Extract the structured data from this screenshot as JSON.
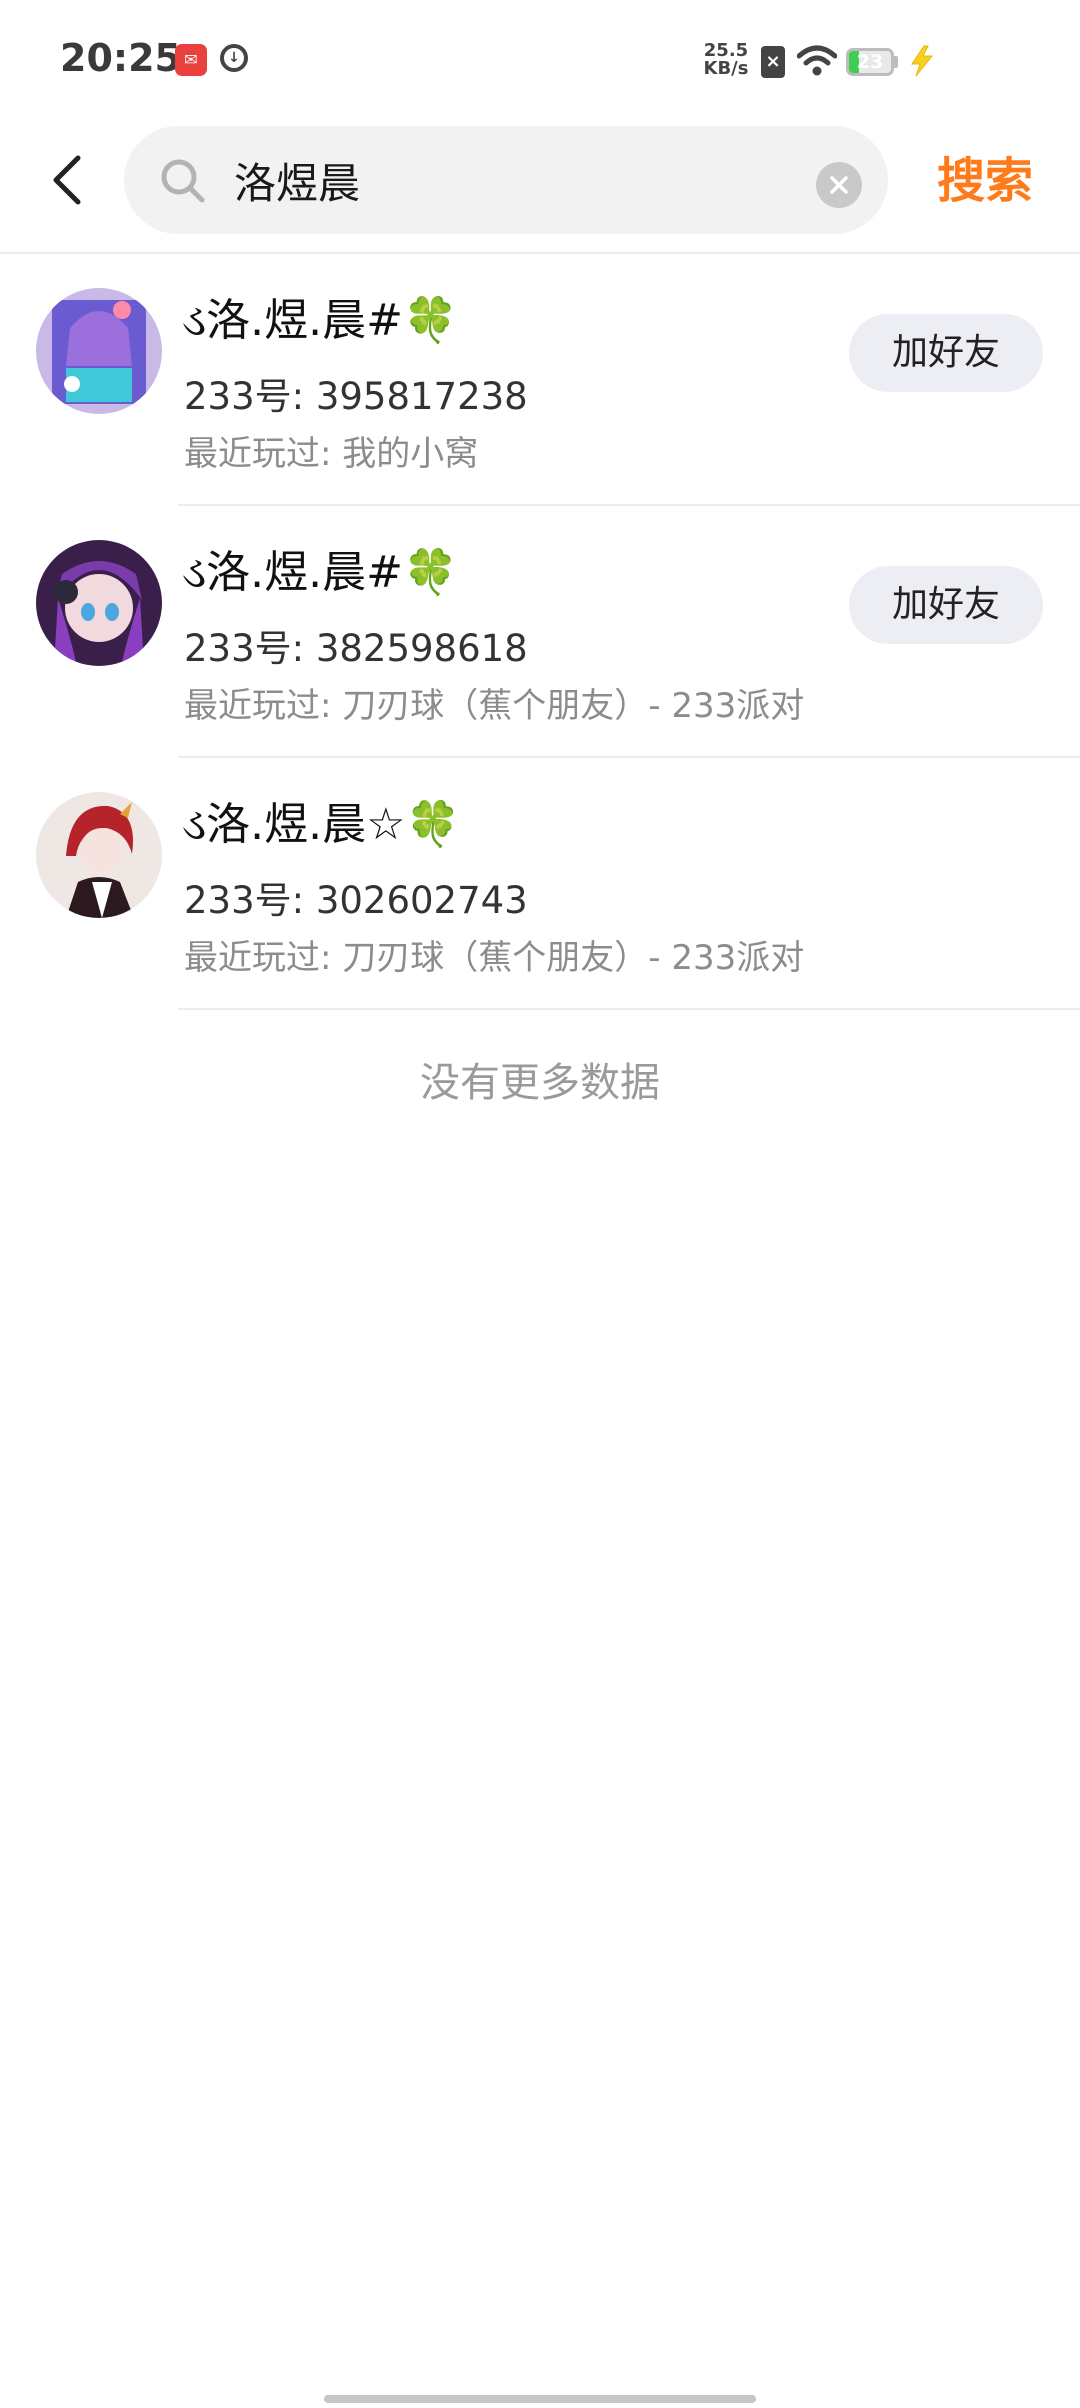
{
  "status_bar": {
    "time": "20:25",
    "net_speed_value": "25.5",
    "net_speed_unit": "KB/s",
    "battery_level": "23",
    "battery_percent": 23,
    "battery_color": "#3ecf50"
  },
  "search": {
    "query": "洛煜晨",
    "submit_label": "搜索",
    "accent_color": "#ff7a1a"
  },
  "results": [
    {
      "nickname_prefix": "ડ洛.煜.晨#",
      "nickname_suffix": "🍀",
      "id_text": "233号: 395817238",
      "recent_text": "最近玩过: 我的小窝",
      "button_label": "加好友"
    },
    {
      "nickname_prefix": "ડ洛.煜.晨#",
      "nickname_suffix": "🍀",
      "id_text": "233号: 382598618",
      "recent_text": "最近玩过: 刀刃球（蕉个朋友）- 233派对",
      "button_label": "加好友"
    },
    {
      "nickname_prefix": "ડ洛.煜.晨☆",
      "nickname_suffix": "🍀",
      "id_text": "233号: 302602743",
      "recent_text": "最近玩过: 刀刃球（蕉个朋友）- 233派对"
    }
  ],
  "footer": {
    "no_more_text": "没有更多数据"
  }
}
